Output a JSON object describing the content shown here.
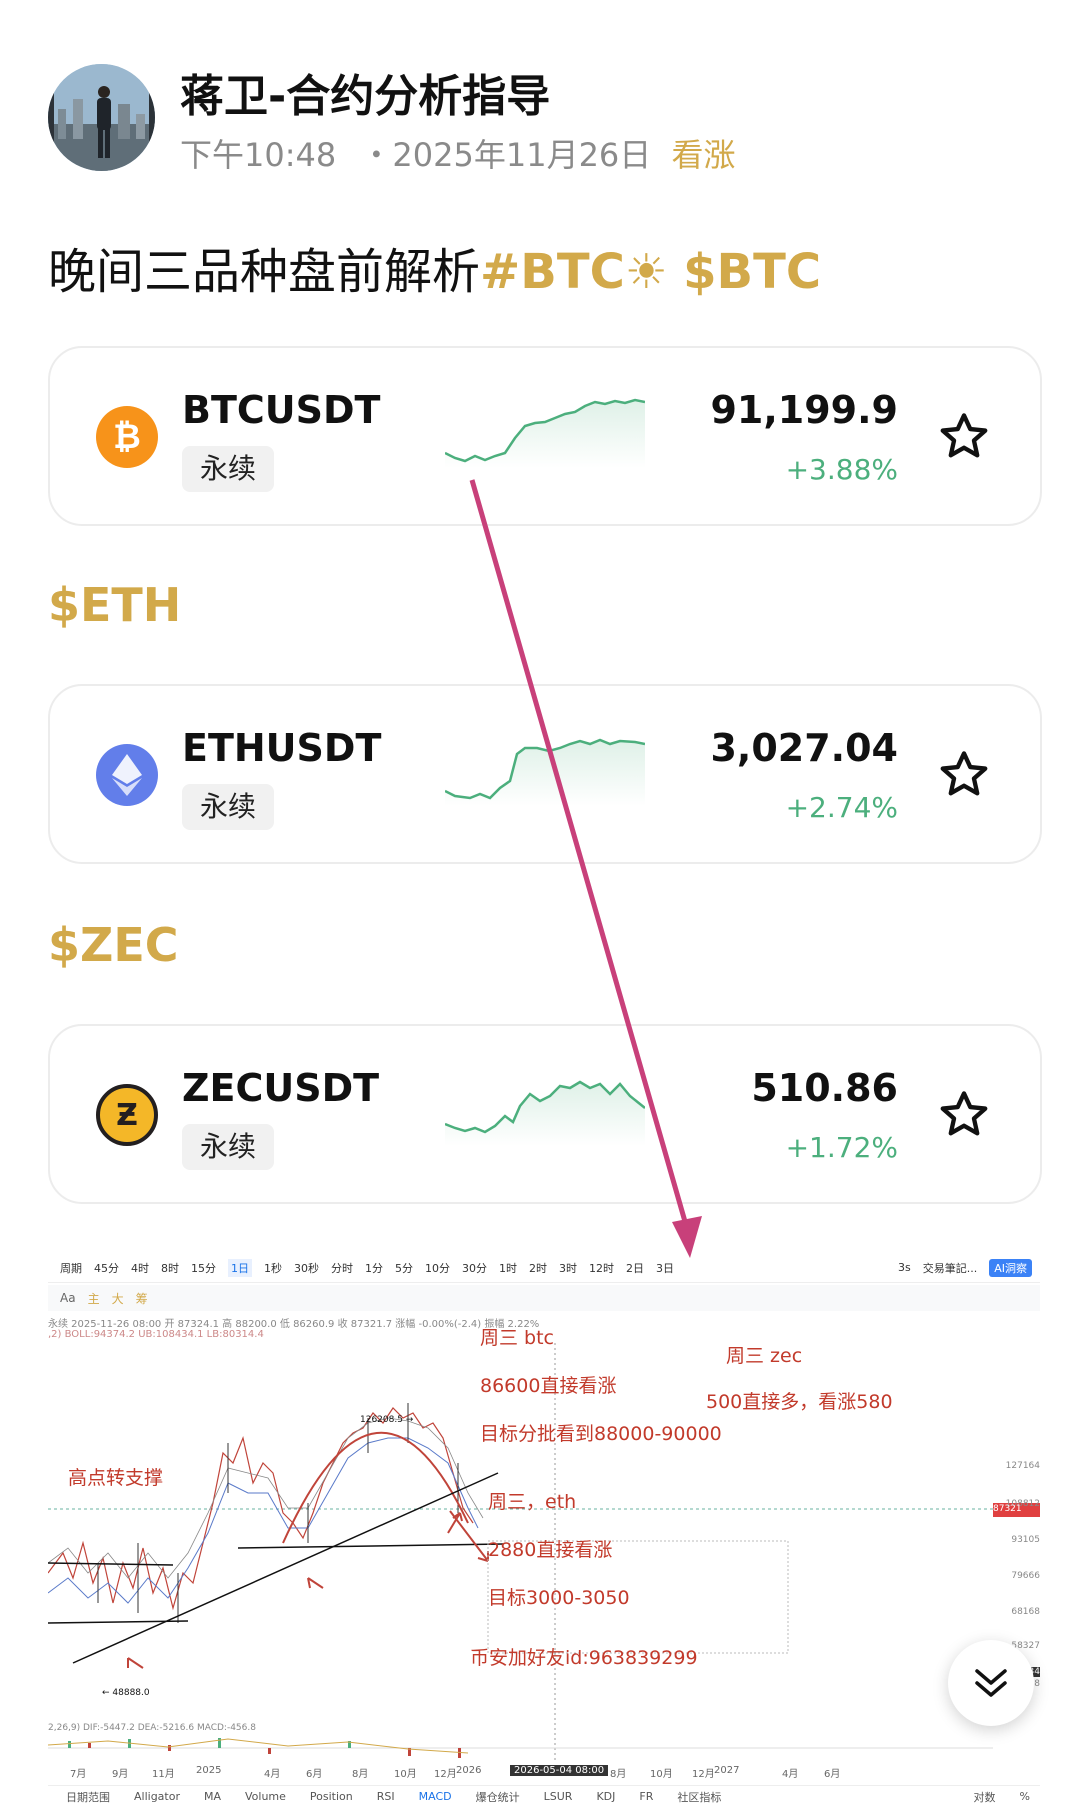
{
  "author": {
    "name": "蒋卫-合约分析指导",
    "time": "下午10:48",
    "date": "・2025年11月26日",
    "sentiment": "看涨"
  },
  "post": {
    "title_text": "晚间三品种盘前解析",
    "title_tag1": "#BTC",
    "title_tag2": "$BTC"
  },
  "cards": [
    {
      "symbol": "BTCUSDT",
      "type": "永续",
      "price": "91,199.9",
      "change": "+3.88%",
      "coin_icon": "bitcoin-icon",
      "color": "#f7931a"
    },
    {
      "symbol": "ETHUSDT",
      "type": "永续",
      "price": "3,027.04",
      "change": "+2.74%",
      "coin_icon": "ethereum-icon",
      "color": "#627eea"
    },
    {
      "symbol": "ZECUSDT",
      "type": "永续",
      "price": "510.86",
      "change": "+1.72%",
      "coin_icon": "zcash-icon",
      "color": "#f4b728"
    }
  ],
  "sections": {
    "eth": "$ETH",
    "zec": "$ZEC"
  },
  "chart": {
    "toolbar": [
      "周期",
      "45分",
      "4时",
      "8时",
      "15分",
      "1日",
      "1秒",
      "30秒",
      "分时",
      "1分",
      "5分",
      "10分",
      "30分",
      "1时",
      "2时",
      "3时",
      "12时",
      "2日",
      "3日"
    ],
    "toolbar_right": [
      "3s",
      "交易筆記...",
      "AI洞察"
    ],
    "toolbar2": [
      "Aa",
      "主",
      "大",
      "筹"
    ],
    "ohlc": "永续 2025-11-26 08:00 开 87324.1 高 88200.0 低 86260.9 收 87321.7 涨幅 -0.00%(-2.4) 振幅 2.22%",
    "boll": ",2) BOLL:94374.2 UB:108434.1 LB:80314.4",
    "peak_label": "126208.5 →",
    "low_label": "← 48888.0",
    "annotations": {
      "btc_title": "周三 btc",
      "btc_entry": "86600直接看涨",
      "btc_target": "目标分批看到88000-90000",
      "zec_title": "周三 zec",
      "zec_entry": "500直接多，看涨580",
      "eth_title": "周三，eth",
      "eth_entry": "2880直接看涨",
      "eth_target": "目标3000-3050",
      "support": "高点转支撑",
      "binance_id": "币安加好友id:963839299"
    },
    "macd": "2,26,9) DIF:-5447.2 DEA:-5216.6 MACD:-456.8",
    "xaxis": [
      "7月",
      "9月",
      "11月",
      "2025",
      "4月",
      "6月",
      "8月",
      "10月",
      "12月",
      "2026",
      "2026-05-04 08:00",
      "8月",
      "10月",
      "12月",
      "2027",
      "4月",
      "6月"
    ],
    "yaxis": [
      "127164",
      "108812",
      "93105",
      "87321",
      "79666",
      "68168",
      "58327",
      "52134",
      "48888"
    ],
    "bottombar": [
      "日期范围",
      "Alligator",
      "MA",
      "Volume",
      "Position",
      "RSI",
      "MACD",
      "爆仓统计",
      "LSUR",
      "KDJ",
      "FR",
      "社区指标",
      "对数",
      "%"
    ]
  },
  "colors": {
    "gold": "#d2a94a",
    "green": "#4caf7d",
    "arrow": "#c8407a"
  }
}
